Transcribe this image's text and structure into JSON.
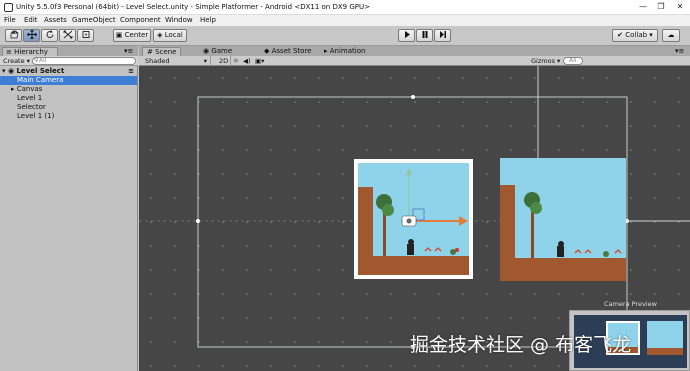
{
  "window": {
    "title": "Unity 5.5.0f3 Personal (64bit) - Level Select.unity - Simple Platformer - Android <DX11 on DX9 GPU>",
    "controls": [
      "—",
      "❐",
      "✕"
    ]
  },
  "menu": [
    "File",
    "Edit",
    "Assets",
    "GameObject",
    "Component",
    "Window",
    "Help"
  ],
  "toolbar": {
    "pivot_label": "Center",
    "space_label": "Local",
    "collab_label": "Collab ▾",
    "tools": [
      "hand-tool",
      "move-tool",
      "rotate-tool",
      "scale-tool",
      "rect-tool"
    ],
    "play_controls": [
      "play",
      "pause",
      "step"
    ]
  },
  "hierarchy": {
    "tab_label": "Hierarchy",
    "create_label": "Create ▾",
    "search_placeholder": "All",
    "scene_name": "Level Select",
    "items": [
      "Main Camera",
      "Canvas",
      "Level 1",
      "Selector",
      "Level 1 (1)"
    ],
    "selected_index": 0
  },
  "scene_tabs": [
    "Scene",
    "Game",
    "Asset Store",
    "Animation"
  ],
  "scene_toolbar": {
    "shading_mode": "Shaded",
    "mode_2d": "2D",
    "gizmos_label": "Gizmos ▾",
    "search_placeholder": "All"
  },
  "camera_preview": {
    "label": "Camera Preview"
  },
  "watermark": "掘金技术社区 @ 布客飞龙",
  "colors": {
    "sky": "#8ed3ea",
    "ground": "#a1582e",
    "selection": "#3d7ed6",
    "viewport_bg": "#464646"
  }
}
